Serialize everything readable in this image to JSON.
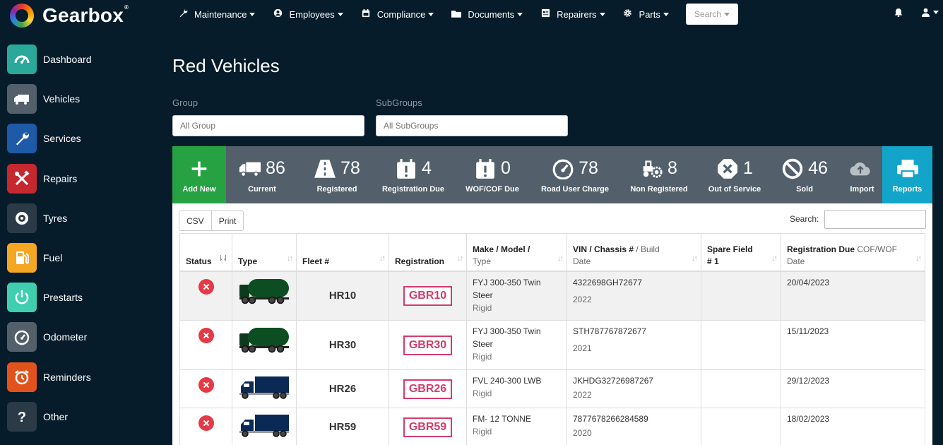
{
  "app": {
    "name": "Gearbox",
    "trademark": "®"
  },
  "nav": {
    "items": [
      {
        "label": "Maintenance",
        "icon": "wrench-icon"
      },
      {
        "label": "Employees",
        "icon": "user-circle-icon"
      },
      {
        "label": "Compliance",
        "icon": "calendar-icon"
      },
      {
        "label": "Documents",
        "icon": "folder-icon"
      },
      {
        "label": "Repairers",
        "icon": "id-card-icon"
      },
      {
        "label": "Parts",
        "icon": "gear-icon"
      }
    ],
    "search_label": "Search"
  },
  "sidebar": {
    "items": [
      {
        "label": "Dashboard",
        "icon": "speedometer-icon",
        "color": "#2aa99b"
      },
      {
        "label": "Vehicles",
        "icon": "truck-icon",
        "color": "#53606b"
      },
      {
        "label": "Services",
        "icon": "wrench-icon",
        "color": "#1e5aa8"
      },
      {
        "label": "Repairs",
        "icon": "tools-icon",
        "color": "#c62830"
      },
      {
        "label": "Tyres",
        "icon": "tyre-icon",
        "color": "#2b3a47"
      },
      {
        "label": "Fuel",
        "icon": "fuel-pump-icon",
        "color": "#f5a623"
      },
      {
        "label": "Prestarts",
        "icon": "power-icon",
        "color": "#3fcfb0"
      },
      {
        "label": "Odometer",
        "icon": "gauge-icon",
        "color": "#53606b"
      },
      {
        "label": "Reminders",
        "icon": "alarm-clock-icon",
        "color": "#e2521d"
      },
      {
        "label": "Other",
        "icon": "question-icon",
        "color": "#2b3a47"
      }
    ]
  },
  "page": {
    "title": "Red Vehicles",
    "group_label": "Group",
    "group_placeholder": "All Group",
    "subgroups_label": "SubGroups",
    "subgroups_placeholder": "All SubGroups"
  },
  "stats": {
    "add_new": "Add New",
    "reports": "Reports",
    "items": [
      {
        "label": "Current",
        "value": "86",
        "icon": "truck-icon"
      },
      {
        "label": "Registered",
        "value": "78",
        "icon": "road-icon"
      },
      {
        "label": "Registration Due",
        "value": "4",
        "icon": "calendar-alert-icon"
      },
      {
        "label": "WOF/COF Due",
        "value": "0",
        "icon": "calendar-alert-icon"
      },
      {
        "label": "Road User Charge",
        "value": "78",
        "icon": "speedometer-icon"
      },
      {
        "label": "Non Registered",
        "value": "8",
        "icon": "tractor-icon"
      },
      {
        "label": "Out of Service",
        "value": "1",
        "icon": "octagon-x-icon"
      },
      {
        "label": "Sold",
        "value": "46",
        "icon": "ban-icon"
      },
      {
        "label": "Import",
        "value": "",
        "icon": "cloud-upload-icon"
      }
    ]
  },
  "toolbar": {
    "csv": "CSV",
    "print": "Print",
    "search_label": "Search:"
  },
  "table": {
    "headers": {
      "status": "Status",
      "type": "Type",
      "fleet": "Fleet #",
      "registration": "Registration",
      "make": "Make / Model /",
      "make2": "Type",
      "vin": "VIN / Chassis #",
      "vin_light": " / Build",
      "vin2": "Date",
      "spare": "Spare Field",
      "spare2": "# 1",
      "due": "Registration Due",
      "due_light": " COF/WOF",
      "due2": "Date"
    },
    "rows": [
      {
        "fleet": "HR10",
        "plate": "GBR10",
        "make": "FYJ 300-350 Twin Steer",
        "type": "Rigid",
        "vin": "4322698GH72677",
        "year": "2022",
        "spare": "",
        "due": "20/04/2023",
        "vehicle": "tanker-icon"
      },
      {
        "fleet": "HR30",
        "plate": "GBR30",
        "make": "FYJ 300-350 Twin Steer",
        "type": "Rigid",
        "vin": "STH787767872677",
        "year": "2021",
        "spare": "",
        "due": "15/11/2023",
        "vehicle": "tanker-icon"
      },
      {
        "fleet": "HR26",
        "plate": "GBR26",
        "make": "FVL 240-300 LWB",
        "type": "Rigid",
        "vin": "JKHDG32726987267",
        "year": "2022",
        "spare": "",
        "due": "29/12/2023",
        "vehicle": "box-truck-icon"
      },
      {
        "fleet": "HR59",
        "plate": "GBR59",
        "make": "FM- 12 TONNE",
        "type": "Rigid",
        "vin": "7877678266284589",
        "year": "2020",
        "spare": "",
        "due": "18/02/2023",
        "vehicle": "box-truck-icon"
      }
    ]
  },
  "colors": {
    "background": "#061c2a",
    "add_new": "#27a243",
    "reports": "#12a5c9",
    "stats_bar": "#53606b",
    "plate": "#d63b6b",
    "status_out": "#e53945"
  }
}
